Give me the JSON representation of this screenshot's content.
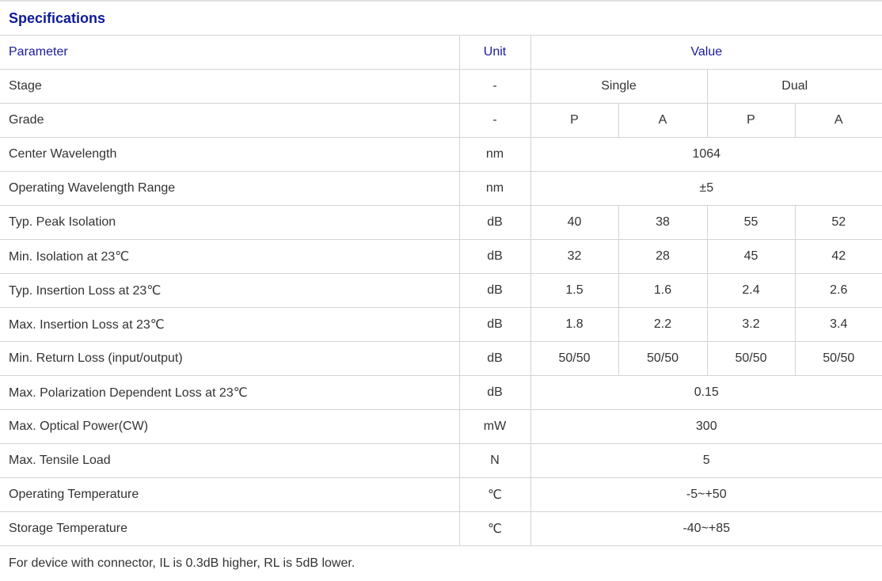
{
  "title": "Specifications",
  "header": {
    "parameter": "Parameter",
    "unit": "Unit",
    "value": "Value"
  },
  "stage": {
    "label": "Stage",
    "unit": "-",
    "single": "Single",
    "dual": "Dual"
  },
  "grade": {
    "label": "Grade",
    "unit": "-",
    "values": [
      "P",
      "A",
      "P",
      "A"
    ]
  },
  "rows_span": {
    "center_wavelength": {
      "label": "Center Wavelength",
      "unit": "nm",
      "value": "1064"
    },
    "operating_range": {
      "label": "Operating Wavelength Range",
      "unit": "nm",
      "value": "±5"
    }
  },
  "rows_split": [
    {
      "label": "Typ. Peak Isolation",
      "unit": "dB",
      "values": [
        "40",
        "38",
        "55",
        "52"
      ]
    },
    {
      "label": "Min. Isolation at 23℃",
      "unit": "dB",
      "values": [
        "32",
        "28",
        "45",
        "42"
      ]
    },
    {
      "label": "Typ. Insertion Loss at 23℃",
      "unit": "dB",
      "values": [
        "1.5",
        "1.6",
        "2.4",
        "2.6"
      ]
    },
    {
      "label": "Max. Insertion Loss at 23℃",
      "unit": "dB",
      "values": [
        "1.8",
        "2.2",
        "3.2",
        "3.4"
      ]
    },
    {
      "label": "Min. Return Loss (input/output)",
      "unit": "dB",
      "values": [
        "50/50",
        "50/50",
        "50/50",
        "50/50"
      ]
    }
  ],
  "rows_span2": [
    {
      "label": "Max. Polarization Dependent Loss at 23℃",
      "unit": "dB",
      "value": "0.15"
    },
    {
      "label": "Max. Optical Power(CW)",
      "unit": "mW",
      "value": "300"
    },
    {
      "label": "Max. Tensile Load",
      "unit": "N",
      "value": "5"
    },
    {
      "label": "Operating Temperature",
      "unit": "℃",
      "value": "-5~+50"
    },
    {
      "label": "Storage Temperature",
      "unit": "℃",
      "value": "-40~+85"
    }
  ],
  "note": "For device with connector, IL is 0.3dB higher, RL is 5dB lower."
}
